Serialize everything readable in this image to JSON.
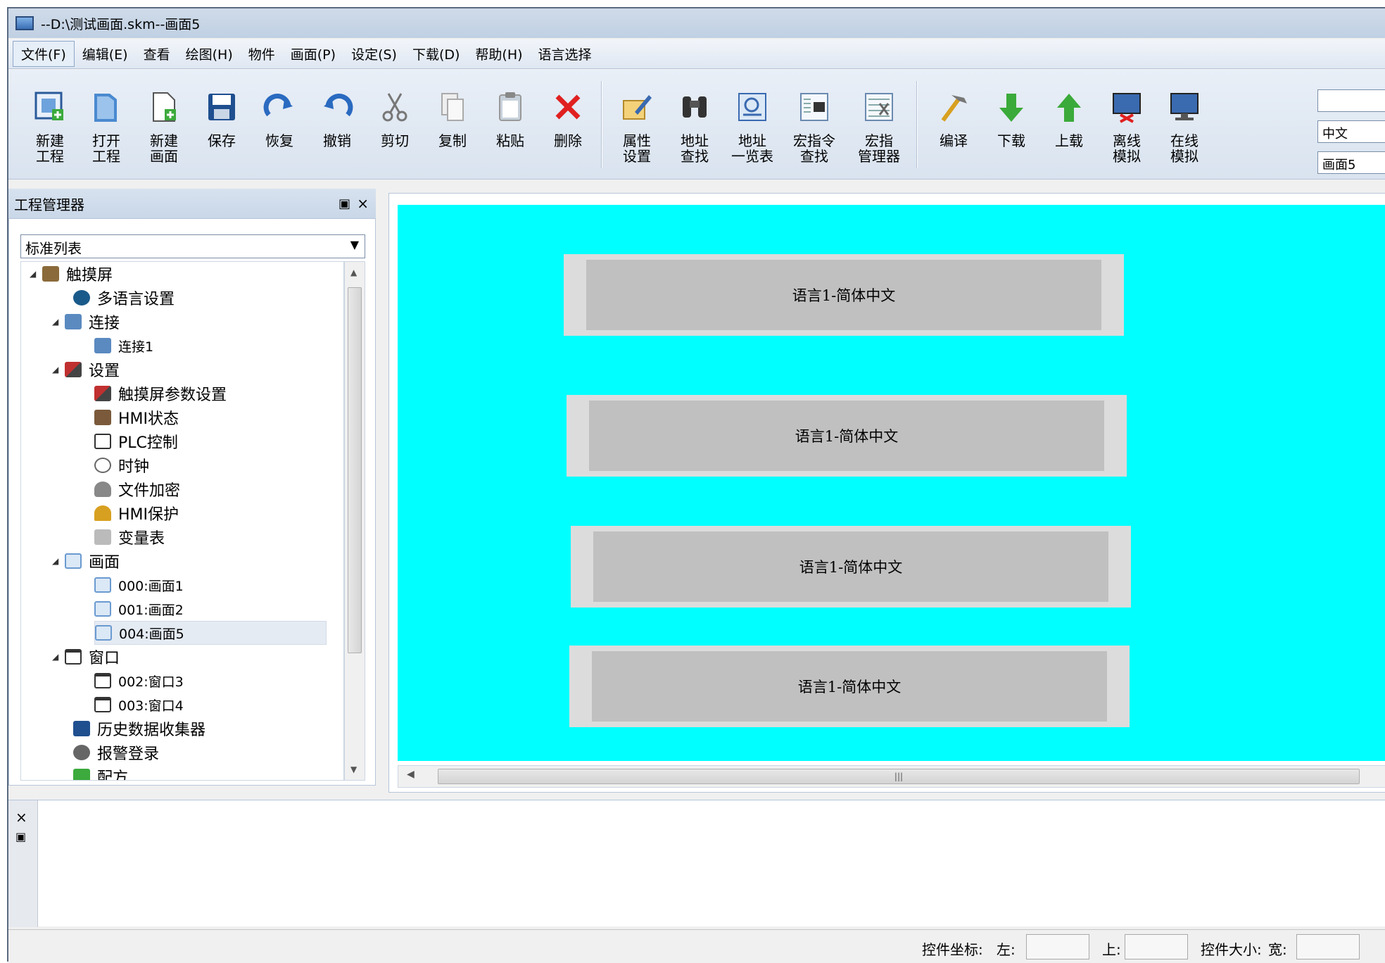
{
  "window": {
    "title": "--D:\\测试画面.skm--画面5"
  },
  "menu": [
    "文件(F)",
    "编辑(E)",
    "查看",
    "绘图(H)",
    "物件",
    "画面(P)",
    "设定(S)",
    "下载(D)",
    "帮助(H)",
    "语言选择"
  ],
  "toolbar": {
    "new_project": "新建\n工程",
    "open_project": "打开\n工程",
    "new_screen": "新建\n画面",
    "save": "保存",
    "redo": "恢复",
    "undo": "撤销",
    "cut": "剪切",
    "copy": "复制",
    "paste": "粘贴",
    "delete": "删除",
    "properties": "属性\n设置",
    "address_find": "地址\n查找",
    "address_list": "地址\n一览表",
    "macro_find": "宏指令\n查找",
    "macro_manager": "宏指\n管理器",
    "compile": "编译",
    "download": "下载",
    "upload": "上载",
    "offline_sim": "离线\n模拟",
    "online_sim": "在线\n模拟",
    "language_field": "中文",
    "screen_field": "画面5"
  },
  "project_manager": {
    "title": "工程管理器",
    "view_select": "标准列表",
    "tree": {
      "touchscreen": "触摸屏",
      "multilang": "多语言设置",
      "connection": "连接",
      "connection1": "连接1",
      "settings": "设置",
      "touch_params": "触摸屏参数设置",
      "hmi_status": "HMI状态",
      "plc_control": "PLC控制",
      "clock": "时钟",
      "file_encrypt": "文件加密",
      "hmi_protect": "HMI保护",
      "var_table": "变量表",
      "screens": "画面",
      "screen1": "000:画面1",
      "screen2": "001:画面2",
      "screen5": "004:画面5",
      "windows": "窗口",
      "window3": "002:窗口3",
      "window4": "003:窗口4",
      "history": "历史数据收集器",
      "alarm": "报警登录",
      "recipe": "配方"
    }
  },
  "canvas": {
    "background": "#00ffff",
    "buttons": [
      "语言1-简体中文",
      "语言1-简体中文",
      "语言1-简体中文",
      "语言1-简体中文"
    ]
  },
  "statusbar": {
    "coord_label": "控件坐标:",
    "left_label": "左:",
    "top_label": "上:",
    "size_label": "控件大小:",
    "width_label": "宽:"
  }
}
